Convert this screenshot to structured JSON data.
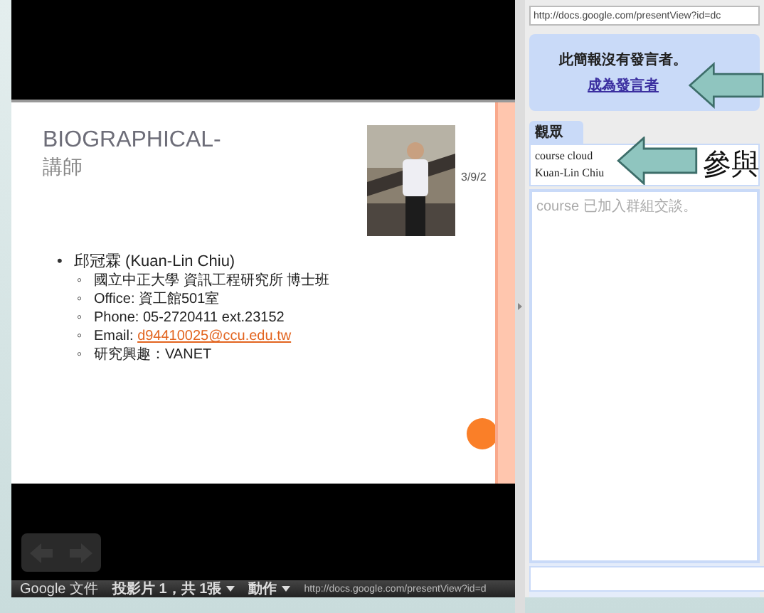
{
  "address": {
    "value": "http://docs.google.com/presentView?id=dc"
  },
  "presenter_notice": {
    "message": "此簡報沒有發言者。",
    "link": "成為發言者"
  },
  "tabs": [
    {
      "label": "觀眾",
      "selected": true
    }
  ],
  "viewers": [
    "course cloud",
    "Kuan-Lin Chiu"
  ],
  "chat": {
    "messages": [
      "course 已加入群組交談。"
    ]
  },
  "annotation": {
    "label": "參與"
  },
  "slide": {
    "title": "BIOGRAPHICAL-",
    "subtitle": "講師",
    "date": "3/9/2",
    "items": [
      {
        "marker": "•",
        "text": "邱冠霖 (Kuan-Lin Chiu)",
        "children": [
          {
            "marker": "◦",
            "text": "國立中正大學 資訊工程研究所 博士班"
          },
          {
            "marker": "◦",
            "text": "Office: 資工館501室"
          },
          {
            "marker": "◦",
            "text": "Phone: 05-2720411 ext.23152"
          },
          {
            "marker": "◦",
            "text": "Email: ",
            "link": "d94410025@ccu.edu.tw"
          },
          {
            "marker": "◦",
            "text": "研究興趣：VANET"
          }
        ]
      }
    ]
  },
  "toolbar": {
    "brand": "Google 文件",
    "slide_menu": "投影片 1，共 1張",
    "actions_menu": "動作",
    "url": "http://docs.google.com/presentView?id=d"
  }
}
